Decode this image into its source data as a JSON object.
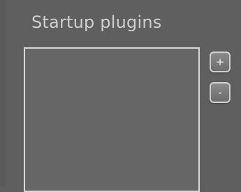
{
  "panel": {
    "title": "Startup plugins"
  },
  "buttons": {
    "add_label": "+",
    "remove_label": "-"
  },
  "list": {
    "items": []
  },
  "colors": {
    "background": "#5f5f5f",
    "list_background": "#666666",
    "border": "#d8d8d8",
    "title_text": "#cfcfcf"
  }
}
